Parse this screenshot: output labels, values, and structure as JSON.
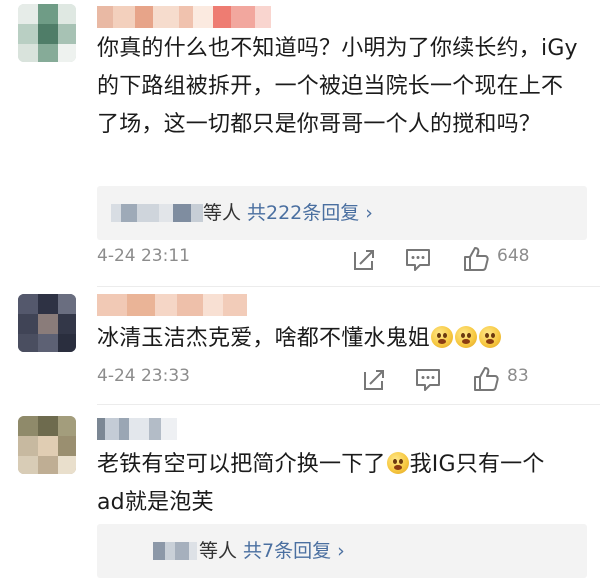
{
  "comments": [
    {
      "text": "你真的什么也不知道吗？小明为了你续长约，iGy的下路组被拆开，一个被迫当院长一个现在上不了场，这一切都只是你哥哥一个人的搅和吗？",
      "replies": {
        "label": "等人",
        "link": "共222条回复 ›"
      },
      "timestamp": "4-24 23:11",
      "likes": "648"
    },
    {
      "text": "冰清玉洁杰克爱，啥都不懂水鬼姐",
      "timestamp": "4-24 23:33",
      "likes": "83"
    },
    {
      "text_before_emoji": "老铁有空可以把简介换一下了",
      "text_after_emoji": "我IG只有一个ad就是泡芙",
      "replies": {
        "label": "等人",
        "link": "共7条回复 ›"
      }
    }
  ],
  "icons": {
    "share": "share-icon",
    "comment": "comment-icon",
    "like": "thumbs-up-icon",
    "emoji": "grimacing-face-emoji"
  },
  "colors": {
    "link": "#4a6fa0",
    "meta": "#8c8c8c",
    "reply_bg": "#f3f3f3"
  }
}
